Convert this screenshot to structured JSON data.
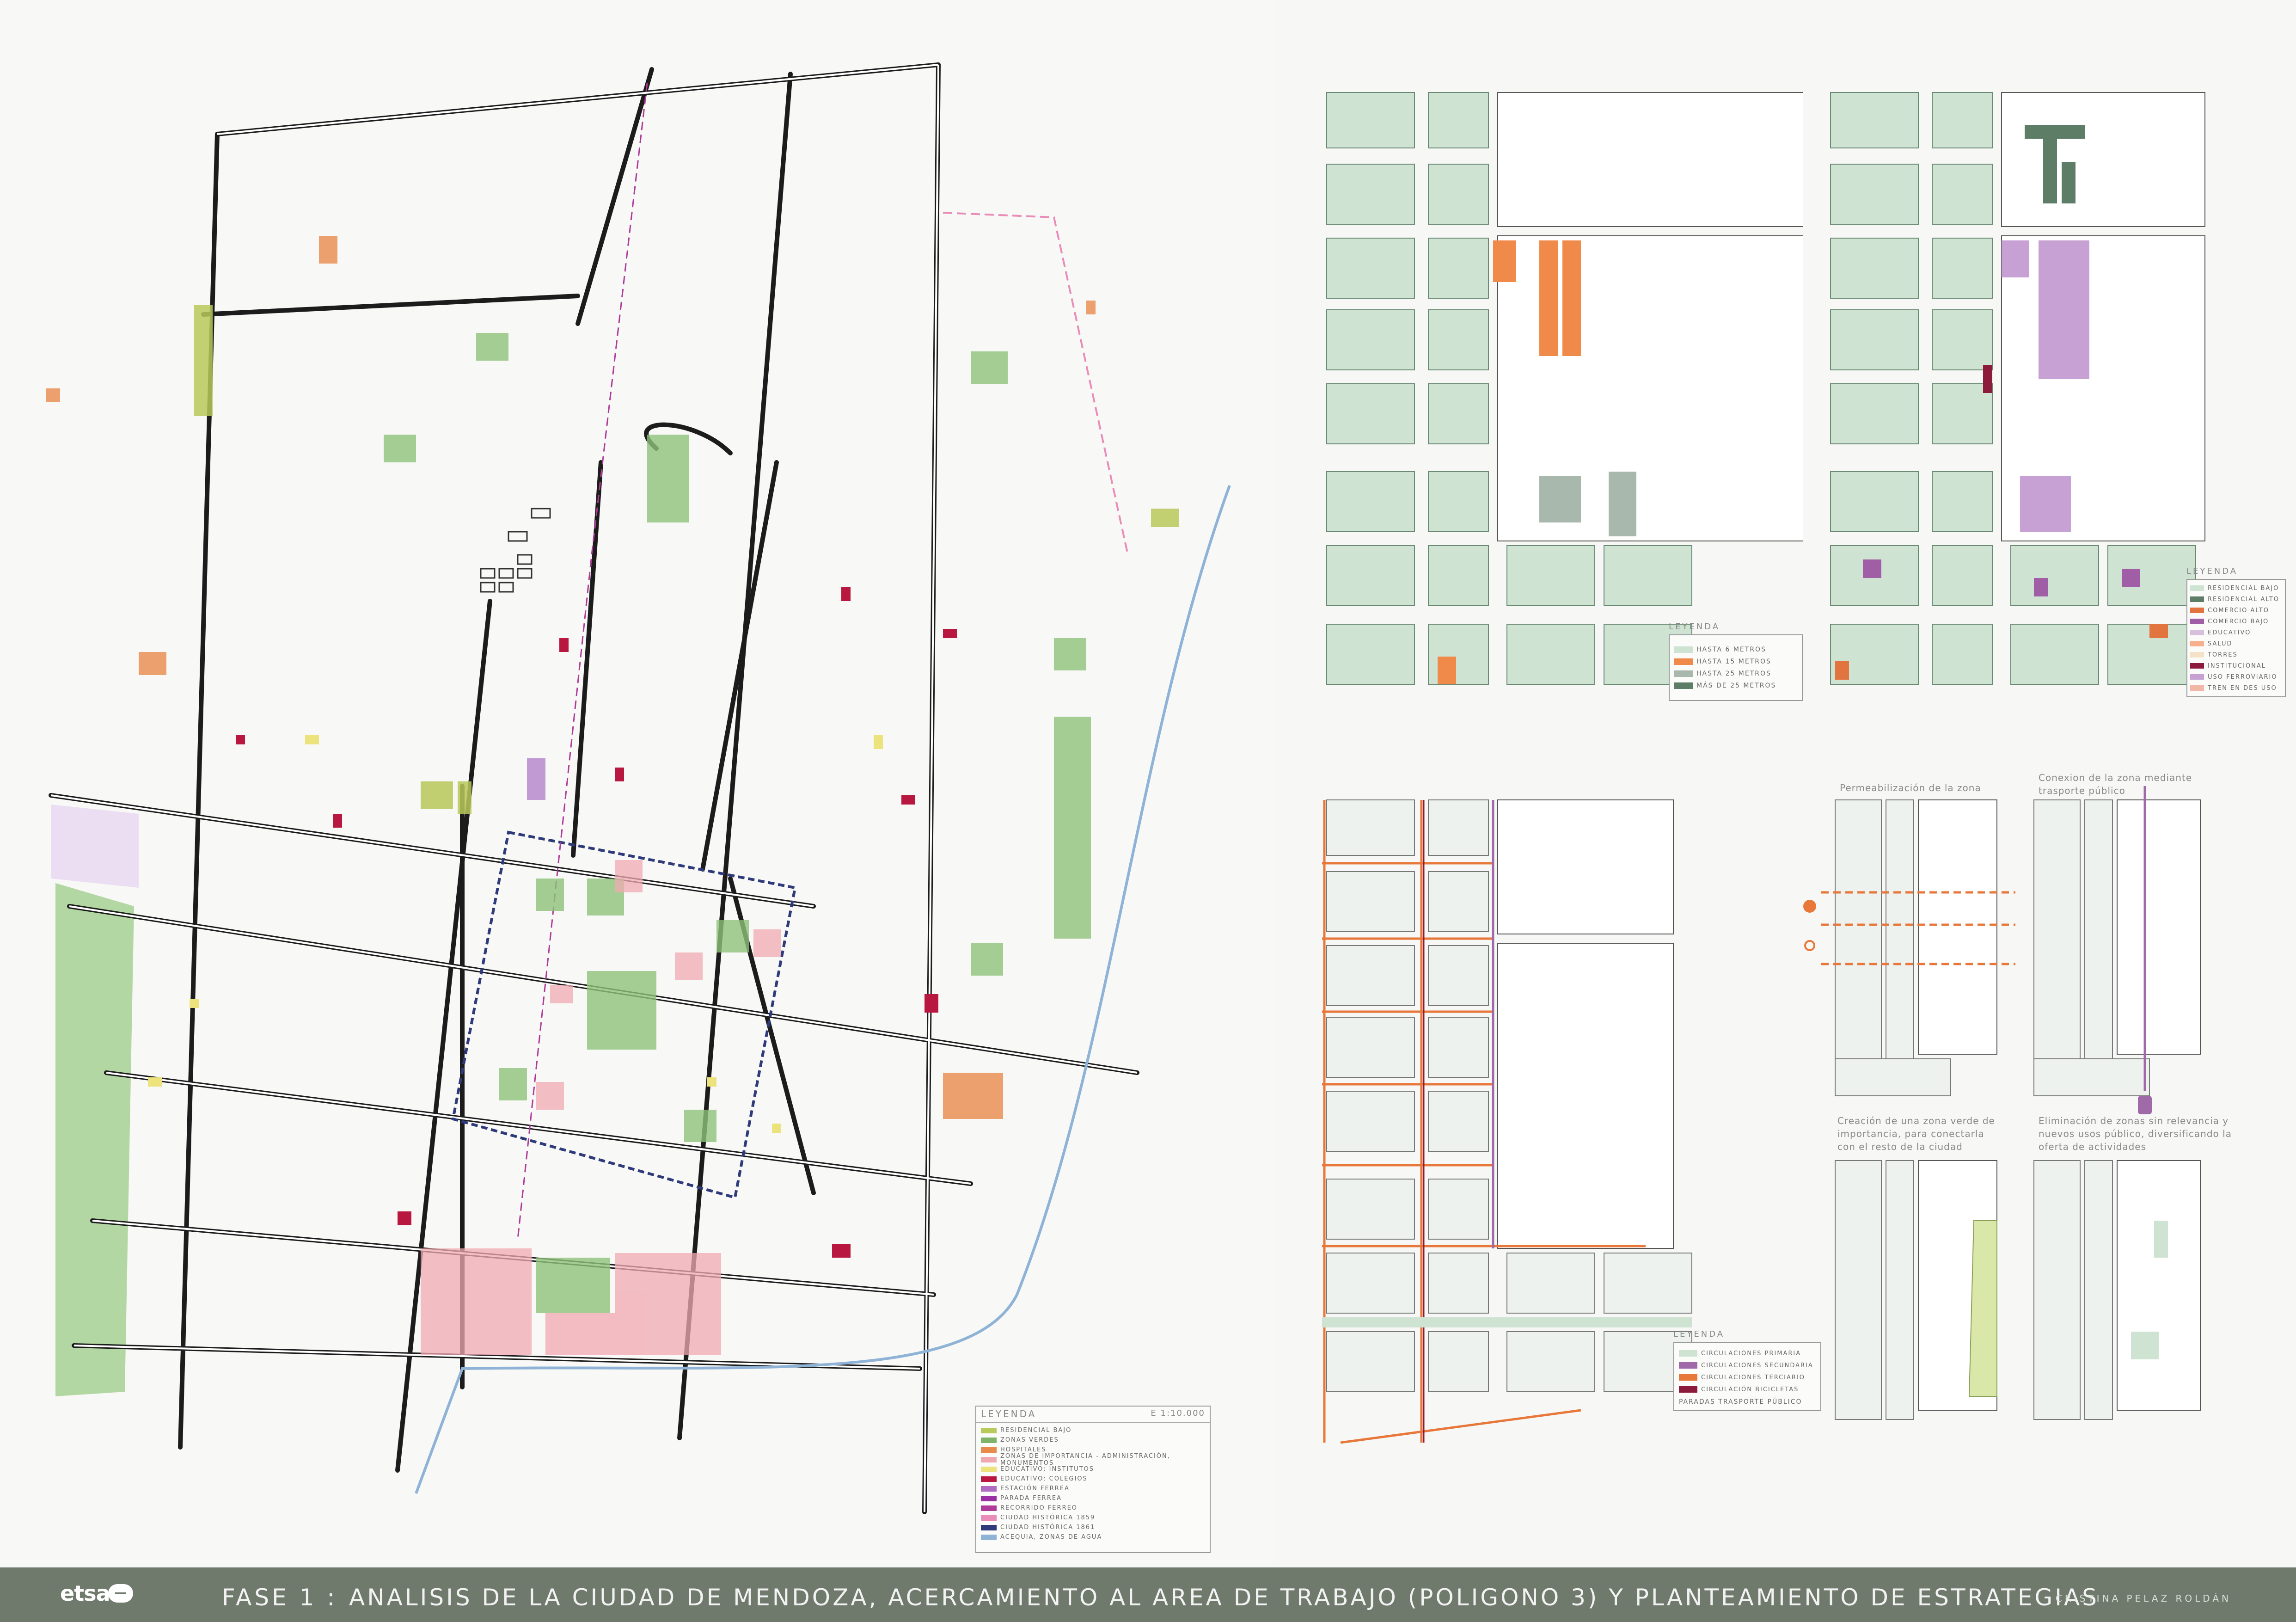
{
  "main_map": {
    "legend": {
      "title": "LEYENDA",
      "scale": "E 1:10.000",
      "items": [
        {
          "label": "RESIDENCIAL BAJO",
          "color": "#b9c95a"
        },
        {
          "label": "ZONAS VERDES",
          "color": "#7fb36a"
        },
        {
          "label": "HOSPITALES",
          "color": "#e88a4a"
        },
        {
          "label": "ZONAS DE IMPORTANCIA - ADMINISTRACIÓN, MONUMENTOS",
          "color": "#f0a9b1"
        },
        {
          "label": "EDUCATIVO: INSTITUTOS",
          "color": "#ece37d"
        },
        {
          "label": "EDUCATIVO: COLEGIOS",
          "color": "#b8173f"
        },
        {
          "label": "ESTACIÓN FERREA",
          "color": "#b06ac2"
        },
        {
          "label": "PARADA FERREA",
          "color": "#9a2ea3"
        },
        {
          "label": "RECORRIDO FERREO",
          "color": "#b03a9a"
        },
        {
          "label": "CIUDAD HISTÓRICA 1859",
          "color": "#e98cb8"
        },
        {
          "label": "CIUDAD HISTÓRICA 1861",
          "color": "#2e3a7a"
        },
        {
          "label": "ACEQUIA, ZONAS DE AGUA",
          "color": "#8fb3d6"
        }
      ]
    }
  },
  "heights_map": {
    "legend": {
      "title": "LEYENDA",
      "items": [
        {
          "label": "HASTA 6 METROS",
          "color": "#cfe3d3"
        },
        {
          "label": "HASTA 15 METROS",
          "color": "#f08a4b"
        },
        {
          "label": "HASTA 25 METROS",
          "color": "#a9b8ad"
        },
        {
          "label": "MÁS DE 25 METROS",
          "color": "#5d7d67"
        }
      ]
    }
  },
  "uses_map": {
    "legend": {
      "title": "LEYENDA",
      "items": [
        {
          "label": "RESIDENCIAL BAJO",
          "color": "#cfe3d3"
        },
        {
          "label": "RESIDENCIAL ALTO",
          "color": "#5d7d67"
        },
        {
          "label": "COMERCIO ALTO",
          "color": "#e2743f"
        },
        {
          "label": "COMERCIO BAJO",
          "color": "#a05ea6"
        },
        {
          "label": "EDUCATIVO",
          "color": "#d7c0dc"
        },
        {
          "label": "SALUD",
          "color": "#f7b08b"
        },
        {
          "label": "TORRES",
          "color": "#f4e2c6"
        },
        {
          "label": "INSTITUCIONAL",
          "color": "#8c1a3a"
        },
        {
          "label": "USO FERROVIARIO",
          "color": "#c7a1d3"
        },
        {
          "label": "TREN EN DES USO",
          "color": "#f4b6a6"
        }
      ]
    }
  },
  "circulation_map": {
    "legend": {
      "title": "LEYENDA",
      "items": [
        {
          "label": "CIRCULACIONES PRIMARIA",
          "color": "#cfe3d3"
        },
        {
          "label": "CIRCULACIONES SECUNDARIA",
          "color": "#a06aa8"
        },
        {
          "label": "CIRCULACIONES TERCIARIO",
          "color": "#e8773a"
        },
        {
          "label": "CIRCULACIÓN BICICLETAS",
          "color": "#8c1a3a"
        }
      ],
      "note": "PARADAS TRASPORTE PÚBLICO"
    }
  },
  "strategies": [
    {
      "title": "Permeabilización de la zona"
    },
    {
      "title": "Conexion de la zona mediante trasporte público"
    },
    {
      "title": "Creación de una zona verde de importancia, para conectarla con el resto de la ciudad"
    },
    {
      "title": "Eliminación de zonas sin relevancia y nuevos usos público, diversificando la oferta de actividades"
    }
  ],
  "footer": {
    "logo_text": "etsa",
    "phase": "FASE 1 :",
    "title": "ANALISIS DE LA CIUDAD DE MENDOZA, ACERCAMIENTO AL AREA DE TRABAJO (POLIGONO 3) Y PLANTEAMIENTO DE ESTRATEGIAS",
    "author": "CRISTINA PELAZ ROLDÁN"
  }
}
